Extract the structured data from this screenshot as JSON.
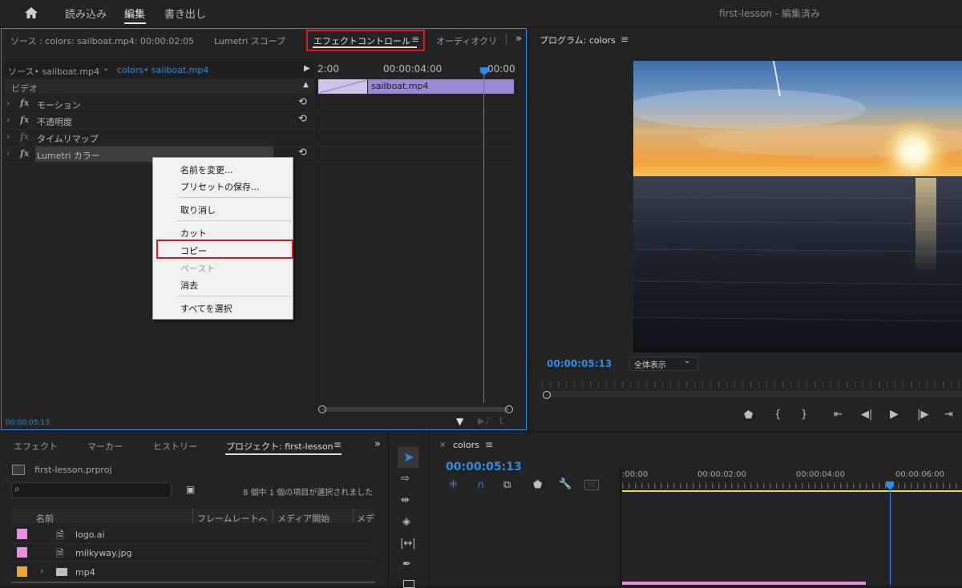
{
  "topbar": {
    "nav": [
      "読み込み",
      "編集",
      "書き出し"
    ],
    "title": "first-lesson - 編集済み"
  },
  "effect_panel": {
    "tabs": [
      "ソース : colors: sailboat.mp4: 00:00:02:05",
      "Lumetri スコープ",
      "エフェクトコントロール",
      "オーディオクリ"
    ],
    "source_tabs": [
      "ソース• sailboat.mp4",
      "colors• sailboat.mp4"
    ],
    "section": "ビデオ",
    "effects": [
      "モーション",
      "不透明度",
      "タイムリマップ",
      "Lumetri カラー"
    ],
    "ruler": [
      "2:00",
      "00:00:04:00",
      "00:00"
    ],
    "clip_name": "sailboat.mp4",
    "timecode": "00:00:05:13"
  },
  "context_menu": {
    "items": [
      "名前を変更...",
      "プリセットの保存...",
      "取り消し",
      "カット",
      "コピー",
      "ペースト",
      "消去",
      "すべてを選択"
    ]
  },
  "program": {
    "title": "プログラム: colors",
    "timecode": "00:00:05:13",
    "zoom": "全体表示"
  },
  "project_panel": {
    "tabs": [
      "エフェクト",
      "マーカー",
      "ヒストリー",
      "プロジェクト: first-lesson"
    ],
    "file": "first-lesson.prproj",
    "selection_info": "8 個中 1 個の項目が選択されました",
    "columns": [
      "名前",
      "フレームレート",
      "メディア開始",
      "メデ"
    ],
    "items": [
      {
        "name": "logo.ai",
        "color": "#e88ee0"
      },
      {
        "name": "milkyway.jpg",
        "color": "#e88ee0"
      },
      {
        "name": "mp4",
        "color": "#f0a32b"
      }
    ]
  },
  "timeline": {
    "sequence": "colors",
    "timecode": "00:00:05:13",
    "ruler": [
      ":00:00",
      "00:00:02:00",
      "00:00:04:00",
      "00:00:06:00"
    ]
  },
  "colors": {
    "accent": "#2d8ceb",
    "highlight": "#e0161b",
    "clip": "#9a87d6"
  }
}
